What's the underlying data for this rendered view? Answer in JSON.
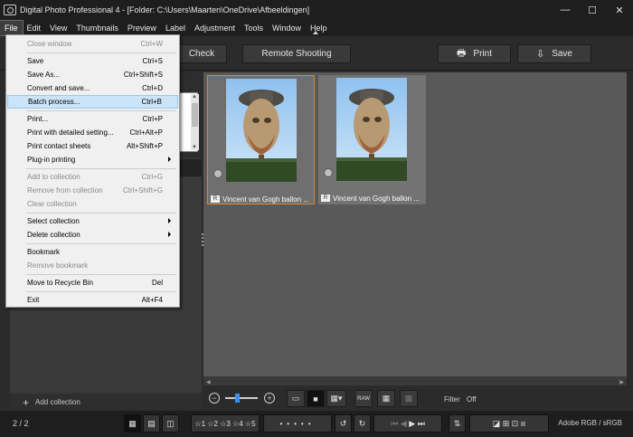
{
  "window": {
    "title": "Digital Photo Professional 4 - [Folder: C:\\Users\\Maarten\\OneDrive\\Afbeeldingen]",
    "minimize": "—",
    "maximize": "☐",
    "close": "✕"
  },
  "menubar": [
    "File",
    "Edit",
    "View",
    "Thumbnails",
    "Preview",
    "Label",
    "Adjustment",
    "Tools",
    "Window",
    "Help"
  ],
  "toolbar": {
    "check_label": "Check",
    "remote_label": "Remote Shooting",
    "print_label": "Print",
    "save_label": "Save"
  },
  "file_menu": [
    {
      "label": "Close window",
      "shortcut": "Ctrl+W",
      "disabled": true
    },
    {
      "label": "Save",
      "shortcut": "Ctrl+S"
    },
    {
      "label": "Save As...",
      "shortcut": "Ctrl+Shift+S"
    },
    {
      "label": "Convert and save...",
      "shortcut": "Ctrl+D"
    },
    {
      "label": "Batch process...",
      "shortcut": "Ctrl+B",
      "highlighted": true
    },
    {
      "label": "Print...",
      "shortcut": "Ctrl+P"
    },
    {
      "label": "Print with detailed setting...",
      "shortcut": "Ctrl+Alt+P"
    },
    {
      "label": "Print contact sheets",
      "shortcut": "Alt+Shift+P"
    },
    {
      "label": "Plug-in printing",
      "submenu": true
    },
    {
      "label": "Add to collection",
      "shortcut": "Ctrl+G",
      "disabled": true
    },
    {
      "label": "Remove from collection",
      "shortcut": "Ctrl+Shift+G",
      "disabled": true
    },
    {
      "label": "Clear collection",
      "disabled": true
    },
    {
      "label": "Select collection",
      "submenu": true
    },
    {
      "label": "Delete collection",
      "submenu": true
    },
    {
      "label": "Bookmark"
    },
    {
      "label": "Remove bookmark",
      "disabled": true
    },
    {
      "label": "Move to Recycle Bin",
      "shortcut": "Del"
    },
    {
      "label": "Exit",
      "shortcut": "Alt+F4"
    }
  ],
  "left_panel": {
    "add_collection_label": "Add collection",
    "add_icon": "+"
  },
  "thumbnails": [
    {
      "filename": "Vincent van Gogh ballon ...",
      "badge": "R",
      "selected": true
    },
    {
      "filename": "Vincent van Gogh ballon ...",
      "badge": "R",
      "selected": false
    }
  ],
  "view_controls": {
    "zoom_out": "−",
    "zoom_in": "+",
    "zoom_level": 0.5,
    "raw_label": "RAW",
    "filter_label": "Filter",
    "filter_value": "Off"
  },
  "statusbar": {
    "count": "2 / 2",
    "stars": [
      "1",
      "2",
      "3",
      "4",
      "5"
    ],
    "color_info": "Adobe RGB / sRGB"
  },
  "colors": {
    "selection": "#d28c39",
    "menu_highlight": "#cce4f7",
    "slider_knob": "#3a8ff0"
  }
}
